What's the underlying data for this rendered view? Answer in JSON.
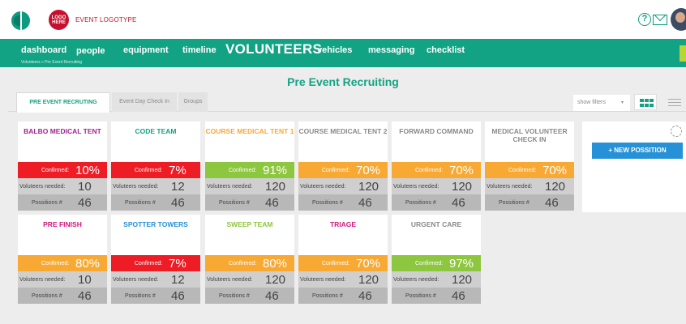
{
  "header": {
    "logo_text": "LOGO HERE",
    "brand_name": "EVENT LOGOTYPE",
    "help_icon": "question-circle-icon",
    "mail_icon": "envelope-icon"
  },
  "nav": {
    "items": [
      "dashboard",
      "people",
      "equipment",
      "timeline",
      "VOLUNTEERS",
      "vehicles",
      "messaging",
      "checklist"
    ],
    "breadcrumb": "Volunteers » Pre Event Recruiting"
  },
  "page_title": "Pre Event Recruiting",
  "tabs": [
    "PRE EVENT RECRUTING",
    "Event Day Check In",
    "Groups"
  ],
  "toolbar": {
    "filters_label": "show filters",
    "caret": "▾"
  },
  "labels": {
    "confirmed": "Confirmed:",
    "needed": "Voluteers needed:",
    "positions": "Possitions #"
  },
  "colors": {
    "red": "#ee1c25",
    "green": "#8dc63f",
    "orange": "#f7a934"
  },
  "cards": [
    {
      "title": "BALBO MEDICAL TENT",
      "title_color": "#a3238e",
      "confirmed": "10%",
      "needed": "10",
      "positions": "46",
      "status": "red"
    },
    {
      "title": "CODE TEAM",
      "title_color": "#12a384",
      "confirmed": "7%",
      "needed": "12",
      "positions": "46",
      "status": "red"
    },
    {
      "title": "COURSE MEDICAL TENT 1",
      "title_color": "#f7a934",
      "confirmed": "91%",
      "needed": "120",
      "positions": "46",
      "status": "green"
    },
    {
      "title": "COURSE MEDICAL TENT 2",
      "title_color": "#8a8a8a",
      "confirmed": "70%",
      "needed": "120",
      "positions": "46",
      "status": "orange"
    },
    {
      "title": "FORWARD COMMAND",
      "title_color": "#8a8a8a",
      "confirmed": "70%",
      "needed": "120",
      "positions": "46",
      "status": "orange"
    },
    {
      "title": "MEDICAL VOLUNTEER CHECK IN",
      "title_color": "#8a8a8a",
      "confirmed": "70%",
      "needed": "120",
      "positions": "46",
      "status": "orange"
    },
    {
      "title": "PRE FINISH",
      "title_color": "#d1187c",
      "confirmed": "80%",
      "needed": "10",
      "positions": "46",
      "status": "orange"
    },
    {
      "title": "SPOTTER TOWERS",
      "title_color": "#2691d6",
      "confirmed": "7%",
      "needed": "12",
      "positions": "46",
      "status": "red"
    },
    {
      "title": "SWEEP TEAM",
      "title_color": "#8dc63f",
      "confirmed": "80%",
      "needed": "120",
      "positions": "46",
      "status": "orange"
    },
    {
      "title": "TRIAGE",
      "title_color": "#d1187c",
      "confirmed": "70%",
      "needed": "120",
      "positions": "46",
      "status": "orange"
    },
    {
      "title": "URGENT CARE",
      "title_color": "#8a8a8a",
      "confirmed": "97%",
      "needed": "120",
      "positions": "46",
      "status": "green"
    }
  ],
  "side": {
    "new_position_label": "+ NEW POSSITION",
    "settings_icon": "gear-icon"
  }
}
